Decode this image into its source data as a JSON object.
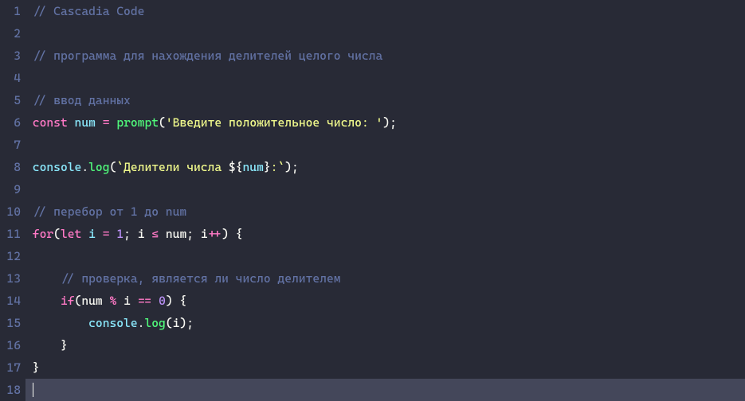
{
  "editor": {
    "theme": "dracula-like",
    "language": "javascript",
    "font_name": "Cascadia Code",
    "cursor_line": 18,
    "lines": [
      {
        "n": 1,
        "tokens": [
          {
            "t": " ",
            "c": "punc"
          },
          {
            "t": "// Cascadia Code",
            "c": "comment"
          }
        ]
      },
      {
        "n": 2,
        "tokens": []
      },
      {
        "n": 3,
        "tokens": [
          {
            "t": " ",
            "c": "punc"
          },
          {
            "t": "// программа для нахождения делителей целого числа",
            "c": "comment"
          }
        ]
      },
      {
        "n": 4,
        "tokens": []
      },
      {
        "n": 5,
        "tokens": [
          {
            "t": " ",
            "c": "punc"
          },
          {
            "t": "// ввод данных",
            "c": "comment"
          }
        ]
      },
      {
        "n": 6,
        "tokens": [
          {
            "t": " ",
            "c": "punc"
          },
          {
            "t": "const",
            "c": "keyword"
          },
          {
            "t": " ",
            "c": "punc"
          },
          {
            "t": "num",
            "c": "ident2"
          },
          {
            "t": " ",
            "c": "punc"
          },
          {
            "t": "=",
            "c": "op"
          },
          {
            "t": " ",
            "c": "punc"
          },
          {
            "t": "prompt",
            "c": "func"
          },
          {
            "t": "(",
            "c": "punc"
          },
          {
            "t": "'Введите положительное число: '",
            "c": "string"
          },
          {
            "t": ");",
            "c": "punc"
          }
        ]
      },
      {
        "n": 7,
        "tokens": []
      },
      {
        "n": 8,
        "tokens": [
          {
            "t": " ",
            "c": "punc"
          },
          {
            "t": "console",
            "c": "ident2"
          },
          {
            "t": ".",
            "c": "punc"
          },
          {
            "t": "log",
            "c": "func"
          },
          {
            "t": "(",
            "c": "punc"
          },
          {
            "t": "`Делители числа ",
            "c": "string"
          },
          {
            "t": "${",
            "c": "interp"
          },
          {
            "t": "num",
            "c": "ident2"
          },
          {
            "t": "}",
            "c": "interp"
          },
          {
            "t": ":`",
            "c": "string"
          },
          {
            "t": ");",
            "c": "punc"
          }
        ]
      },
      {
        "n": 9,
        "tokens": []
      },
      {
        "n": 10,
        "tokens": [
          {
            "t": " ",
            "c": "punc"
          },
          {
            "t": "// перебор от 1 до num",
            "c": "comment"
          }
        ]
      },
      {
        "n": 11,
        "tokens": [
          {
            "t": " ",
            "c": "punc"
          },
          {
            "t": "for",
            "c": "keyword"
          },
          {
            "t": "(",
            "c": "punc"
          },
          {
            "t": "let",
            "c": "keyword"
          },
          {
            "t": " ",
            "c": "punc"
          },
          {
            "t": "i",
            "c": "ident2"
          },
          {
            "t": " ",
            "c": "punc"
          },
          {
            "t": "=",
            "c": "op"
          },
          {
            "t": " ",
            "c": "punc"
          },
          {
            "t": "1",
            "c": "num"
          },
          {
            "t": "; ",
            "c": "punc"
          },
          {
            "t": "i",
            "c": "ident"
          },
          {
            "t": " ",
            "c": "punc"
          },
          {
            "t": "≤",
            "c": "op"
          },
          {
            "t": " ",
            "c": "punc"
          },
          {
            "t": "num",
            "c": "ident"
          },
          {
            "t": "; ",
            "c": "punc"
          },
          {
            "t": "i",
            "c": "ident"
          },
          {
            "t": "++",
            "c": "op"
          },
          {
            "t": ") {",
            "c": "punc"
          }
        ]
      },
      {
        "n": 12,
        "tokens": []
      },
      {
        "n": 13,
        "tokens": [
          {
            "t": "     ",
            "c": "punc"
          },
          {
            "t": "// проверка, является ли число делителем",
            "c": "comment"
          }
        ]
      },
      {
        "n": 14,
        "tokens": [
          {
            "t": "     ",
            "c": "punc"
          },
          {
            "t": "if",
            "c": "keyword"
          },
          {
            "t": "(",
            "c": "punc"
          },
          {
            "t": "num",
            "c": "ident"
          },
          {
            "t": " ",
            "c": "punc"
          },
          {
            "t": "%",
            "c": "op"
          },
          {
            "t": " ",
            "c": "punc"
          },
          {
            "t": "i",
            "c": "ident"
          },
          {
            "t": " ",
            "c": "punc"
          },
          {
            "t": "==",
            "c": "op"
          },
          {
            "t": " ",
            "c": "punc"
          },
          {
            "t": "0",
            "c": "num"
          },
          {
            "t": ") {",
            "c": "punc"
          }
        ]
      },
      {
        "n": 15,
        "tokens": [
          {
            "t": "         ",
            "c": "punc"
          },
          {
            "t": "console",
            "c": "ident2"
          },
          {
            "t": ".",
            "c": "punc"
          },
          {
            "t": "log",
            "c": "func"
          },
          {
            "t": "(",
            "c": "punc"
          },
          {
            "t": "i",
            "c": "ident"
          },
          {
            "t": ");",
            "c": "punc"
          }
        ]
      },
      {
        "n": 16,
        "tokens": [
          {
            "t": "     }",
            "c": "punc"
          }
        ]
      },
      {
        "n": 17,
        "tokens": [
          {
            "t": " }",
            "c": "punc"
          }
        ]
      },
      {
        "n": 18,
        "tokens": [
          {
            "t": " ",
            "c": "punc"
          }
        ],
        "cursor": true
      }
    ]
  }
}
